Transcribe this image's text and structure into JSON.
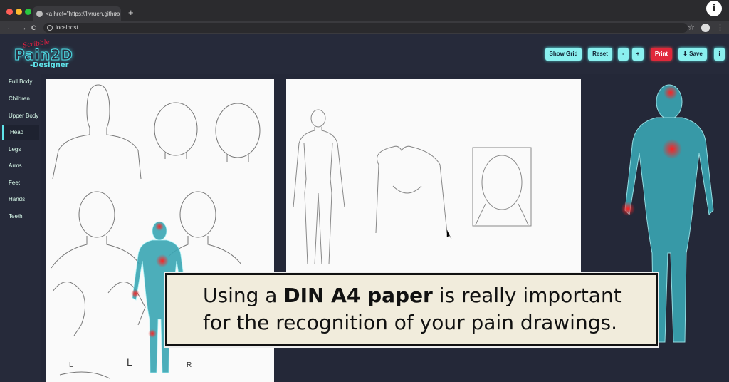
{
  "browser": {
    "tab_title": "<a href=\"https://livruen.github",
    "tab_close": "×",
    "new_tab": "+",
    "url": "localhost",
    "back": "←",
    "forward": "→",
    "reload": "C",
    "star": "☆",
    "menu": "⋮",
    "info_overlay": "i"
  },
  "app": {
    "logo_main": "Pain2D",
    "logo_sub": "-Designer",
    "logo_scribble": "Scribble",
    "toolbar": {
      "show_grid": "Show Grid",
      "reset": "Reset",
      "zoom_out": "-",
      "zoom_in": "+",
      "print": "Print",
      "save": "⬇ Save",
      "info": "i"
    },
    "sidebar": {
      "items": [
        {
          "label": "Full Body"
        },
        {
          "label": "Children"
        },
        {
          "label": "Upper Body"
        },
        {
          "label": "Head",
          "active": true
        },
        {
          "label": "Legs"
        },
        {
          "label": "Arms"
        },
        {
          "label": "Feet"
        },
        {
          "label": "Hands"
        },
        {
          "label": "Teeth"
        }
      ]
    },
    "sheet_labels": {
      "l1": "L",
      "l2": "L",
      "r1": "R"
    }
  },
  "caption": {
    "line1_pre": "Using a ",
    "line1_bold": "DIN A4 paper",
    "line1_post": " is really important",
    "line2": "for the recognition of your pain drawings."
  },
  "colors": {
    "accent": "#8af0ef",
    "print": "#e0283a",
    "background": "#242838"
  }
}
